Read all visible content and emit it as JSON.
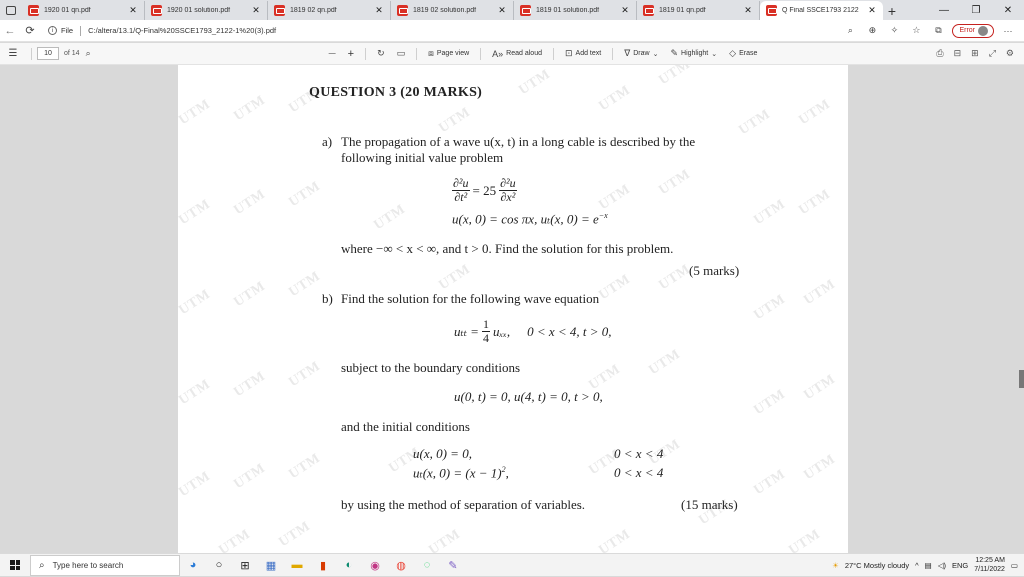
{
  "browser": {
    "tabs": [
      {
        "label": "1920 01 qn.pdf",
        "active": false
      },
      {
        "label": "1920 01 solution.pdf",
        "active": false
      },
      {
        "label": "1819 02 qn.pdf",
        "active": false
      },
      {
        "label": "1819 02 solution.pdf",
        "active": false
      },
      {
        "label": "1819 01 solution.pdf",
        "active": false
      },
      {
        "label": "1819 01 qn.pdf",
        "active": false
      },
      {
        "label": "Q Final SSCE1793 2122",
        "active": true
      }
    ],
    "url_prefix": "File",
    "url": "C:/altera/13.1/Q-Final%20SSCE1793_2122-1%20(3).pdf",
    "error_label": "Error"
  },
  "pdf_toolbar": {
    "current_page": "10",
    "page_count": "of 14",
    "zoom_out": "—",
    "zoom_in": "+",
    "page_view": "Page view",
    "read_aloud": "Read aloud",
    "add_text": "Add text",
    "draw": "Draw",
    "highlight": "Highlight",
    "erase": "Erase"
  },
  "document": {
    "watermark": "UTM",
    "question_title": "QUESTION 3 (20 MARKS)",
    "part_a": {
      "label": "a)",
      "intro_line1": "The propagation of a wave u(x, t) in a long cable is described by the",
      "intro_line2": "following initial value problem",
      "eq1_lhs_num": "∂²u",
      "eq1_lhs_den": "∂t²",
      "eq1_mid": "= 25",
      "eq1_rhs_num": "∂²u",
      "eq1_rhs_den": "∂x²",
      "eq2": "u(x, 0) = cos πx,   uₜ(x, 0) = e",
      "eq2_sup": "−x",
      "where_line": "where −∞ < x < ∞, and t > 0. Find the solution for this problem.",
      "marks": "(5 marks)"
    },
    "part_b": {
      "label": "b)",
      "intro": "Find the solution for the following wave equation",
      "eq_lhs": "uₜₜ =",
      "eq_frac_num": "1",
      "eq_frac_den": "4",
      "eq_rhs": "uₓₓ,",
      "eq_domain": "0 < x < 4,  t > 0,",
      "bc_intro": "subject to the boundary conditions",
      "bc_eq": "u(0, t) = 0,   u(4, t) = 0,   t > 0,",
      "ic_intro": "and the initial conditions",
      "ic_eq1": "u(x, 0) = 0,",
      "ic_eq1_range": "0 < x < 4",
      "ic_eq2": "uₜ(x, 0) = (x − 1)",
      "ic_eq2_sup": "2",
      "ic_eq2_end": ",",
      "ic_eq2_range": "0 < x < 4",
      "method_line": "by using the method of separation of variables.",
      "marks": "(15 marks)"
    }
  },
  "taskbar": {
    "search_placeholder": "Type here to search",
    "weather": "27°C  Mostly cloudy",
    "language": "ENG",
    "time": "12:25 AM",
    "date": "7/11/2022"
  }
}
